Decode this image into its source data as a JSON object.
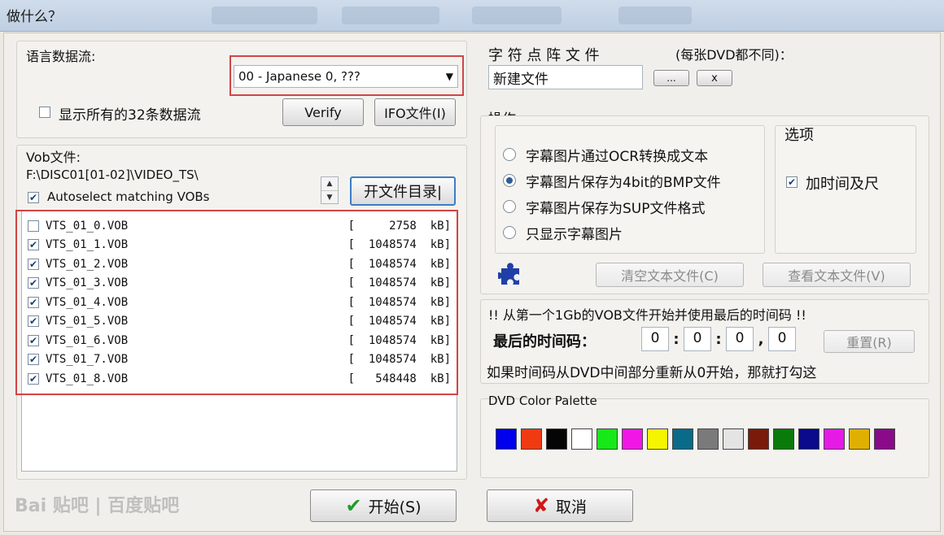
{
  "window": {
    "title": "做什么？"
  },
  "stream": {
    "label": "语言数据流:",
    "selected": "00 - Japanese 0, ???",
    "show_all_label": "显示所有的32条数据流",
    "verify_label": "Verify",
    "ifo_label": "IFO文件(I)"
  },
  "vob": {
    "label": "Vob文件:",
    "path": "F:\\DISC01[01-02]\\VIDEO_TS\\",
    "autoselect_label": "Autoselect matching VOBs",
    "open_dir_label": "开文件目录|",
    "files": [
      {
        "name": "VTS_01_0.VOB",
        "size": "[     2758  kB]",
        "checked": false
      },
      {
        "name": "VTS_01_1.VOB",
        "size": "[  1048574  kB]",
        "checked": true
      },
      {
        "name": "VTS_01_2.VOB",
        "size": "[  1048574  kB]",
        "checked": true
      },
      {
        "name": "VTS_01_3.VOB",
        "size": "[  1048574  kB]",
        "checked": true
      },
      {
        "name": "VTS_01_4.VOB",
        "size": "[  1048574  kB]",
        "checked": true
      },
      {
        "name": "VTS_01_5.VOB",
        "size": "[  1048574  kB]",
        "checked": true
      },
      {
        "name": "VTS_01_6.VOB",
        "size": "[  1048574  kB]",
        "checked": true
      },
      {
        "name": "VTS_01_7.VOB",
        "size": "[  1048574  kB]",
        "checked": true
      },
      {
        "name": "VTS_01_8.VOB",
        "size": "[   548448  kB]",
        "checked": true
      }
    ]
  },
  "charmap": {
    "label": "字 符 点 阵 文 件",
    "note": "(每张DVD都不同)：",
    "value": "新建文件",
    "browse_label": "...",
    "clear_label": "x"
  },
  "operation": {
    "label": "操作:",
    "options": [
      {
        "label": "字幕图片通过OCR转换成文本",
        "selected": false
      },
      {
        "label": "字幕图片保存为4bit的BMP文件",
        "selected": true
      },
      {
        "label": "字幕图片保存为SUP文件格式",
        "selected": false
      },
      {
        "label": "只显示字幕图片",
        "selected": false
      }
    ],
    "options_group_label": "选项",
    "add_time_label": "加时间及尺",
    "clear_text_label": "清空文本文件(C)",
    "view_text_label": "查看文本文件(V)"
  },
  "timecode": {
    "info": "!! 从第一个1Gb的VOB文件开始并使用最后的时间码 !!",
    "label": "最后的时间码：",
    "fields": [
      "0",
      "0",
      "0",
      "0"
    ],
    "separators": [
      ":",
      ":",
      ","
    ],
    "reset_label": "重置(R)",
    "hint": "如果时间码从DVD中间部分重新从0开始，那就打勾这"
  },
  "palette": {
    "label": "DVD Color Palette",
    "colors": [
      "#0000ee",
      "#f03a12",
      "#050505",
      "#ffffff",
      "#17e817",
      "#f216e6",
      "#f5f500",
      "#0a6a8a",
      "#7a7a7a",
      "#e4e4e4",
      "#7a1a0a",
      "#0a7a0a",
      "#0a0a8a",
      "#e61ae6",
      "#e0b000",
      "#8a0a8a"
    ]
  },
  "actions": {
    "start_label": "开始(S)",
    "cancel_label": "取消"
  },
  "watermark": {
    "text": "Bai 贴吧 | 百度贴吧"
  }
}
